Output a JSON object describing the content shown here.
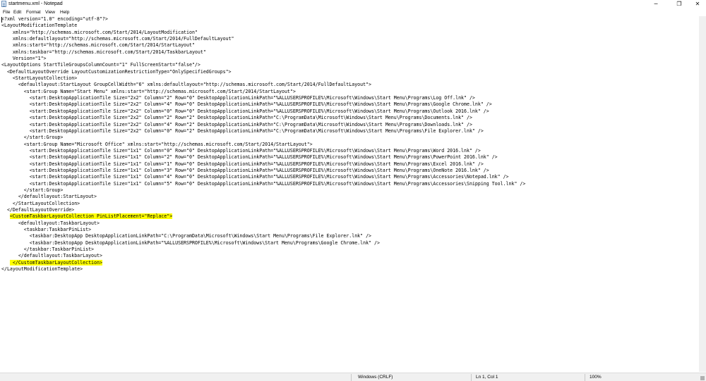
{
  "window": {
    "title": "startmenu.xml - Notepad",
    "minimize": "─",
    "maximize": "❐",
    "close": "✕"
  },
  "menu": {
    "file": "File",
    "edit": "Edit",
    "format": "Format",
    "view": "View",
    "help": "Help"
  },
  "editor": {
    "lines": [
      {
        "text": "<?xml version=\"1.0\" encoding=\"utf-8\"?>"
      },
      {
        "text": "<LayoutModificationTemplate"
      },
      {
        "text": "    xmlns=\"http://schemas.microsoft.com/Start/2014/LayoutModification\""
      },
      {
        "text": "    xmlns:defaultlayout=\"http://schemas.microsoft.com/Start/2014/FullDefaultLayout\""
      },
      {
        "text": "    xmlns:start=\"http://schemas.microsoft.com/Start/2014/StartLayout\""
      },
      {
        "text": "    xmlns:taskbar=\"http://schemas.microsoft.com/Start/2014/TaskbarLayout\""
      },
      {
        "text": "    Version=\"1\">"
      },
      {
        "text": "<LayoutOptions StartTileGroupsColumnCount=\"1\" FullScreenStart=\"false\"/>"
      },
      {
        "text": "  <DefaultLayoutOverride LayoutCustomizationRestrictionType=\"OnlySpecifiedGroups\">"
      },
      {
        "text": "    <StartLayoutCollection>"
      },
      {
        "text": "      <defaultlayout:StartLayout GroupCellWidth=\"6\" xmlns:defaultlayout=\"http://schemas.microsoft.com/Start/2014/FullDefaultLayout\">"
      },
      {
        "text": "        <start:Group Name=\"Start Menu\" xmlns:start=\"http://schemas.microsoft.com/Start/2014/StartLayout\">"
      },
      {
        "text": "          <start:DesktopApplicationTile Size=\"2x2\" Column=\"2\" Row=\"0\" DesktopApplicationLinkPath=\"%ALLUSERSPROFILE%\\Microsoft\\Windows\\Start Menu\\Programs\\Log Off.lnk\" />"
      },
      {
        "text": "          <start:DesktopApplicationTile Size=\"2x2\" Column=\"4\" Row=\"0\" DesktopApplicationLinkPath=\"%ALLUSERSPROFILE%\\Microsoft\\Windows\\Start Menu\\Programs\\Google Chrome.lnk\" />"
      },
      {
        "text": "          <start:DesktopApplicationTile Size=\"2x2\" Column=\"0\" Row=\"0\" DesktopApplicationLinkPath=\"%ALLUSERSPROFILE%\\Microsoft\\Windows\\Start Menu\\Programs\\Outlook 2016.lnk\" />"
      },
      {
        "text": "          <start:DesktopApplicationTile Size=\"2x2\" Column=\"2\" Row=\"2\" DesktopApplicationLinkPath=\"C:\\ProgramData\\Microsoft\\Windows\\Start Menu\\Programs\\Documents.lnk\" />"
      },
      {
        "text": "          <start:DesktopApplicationTile Size=\"2x2\" Column=\"4\" Row=\"2\" DesktopApplicationLinkPath=\"C:\\ProgramData\\Microsoft\\Windows\\Start Menu\\Programs\\Downloads.lnk\" />"
      },
      {
        "text": "          <start:DesktopApplicationTile Size=\"2x2\" Column=\"0\" Row=\"2\" DesktopApplicationLinkPath=\"C:\\ProgramData\\Microsoft\\Windows\\Start Menu\\Programs\\File Explorer.lnk\" />"
      },
      {
        "text": "        </start:Group>"
      },
      {
        "text": "        <start:Group Name=\"Microsoft Office\" xmlns:start=\"http://schemas.microsoft.com/Start/2014/StartLayout\">"
      },
      {
        "text": "          <start:DesktopApplicationTile Size=\"1x1\" Column=\"0\" Row=\"0\" DesktopApplicationLinkPath=\"%ALLUSERSPROFILE%\\Microsoft\\Windows\\Start Menu\\Programs\\Word 2016.lnk\" />"
      },
      {
        "text": "          <start:DesktopApplicationTile Size=\"1x1\" Column=\"2\" Row=\"0\" DesktopApplicationLinkPath=\"%ALLUSERSPROFILE%\\Microsoft\\Windows\\Start Menu\\Programs\\PowerPoint 2016.lnk\" />"
      },
      {
        "text": "          <start:DesktopApplicationTile Size=\"1x1\" Column=\"1\" Row=\"0\" DesktopApplicationLinkPath=\"%ALLUSERSPROFILE%\\Microsoft\\Windows\\Start Menu\\Programs\\Excel 2016.lnk\" />"
      },
      {
        "text": "          <start:DesktopApplicationTile Size=\"1x1\" Column=\"3\" Row=\"0\" DesktopApplicationLinkPath=\"%ALLUSERSPROFILE%\\Microsoft\\Windows\\Start Menu\\Programs\\OneNote 2016.lnk\" />"
      },
      {
        "text": "          <start:DesktopApplicationTile Size=\"1x1\" Column=\"4\" Row=\"0\" DesktopApplicationLinkPath=\"%ALLUSERSPROFILE%\\Microsoft\\Windows\\Start Menu\\Programs\\Accessories\\Notepad.lnk\" />"
      },
      {
        "text": "          <start:DesktopApplicationTile Size=\"1x1\" Column=\"5\" Row=\"0\" DesktopApplicationLinkPath=\"%ALLUSERSPROFILE%\\Microsoft\\Windows\\Start Menu\\Programs\\Accessories\\Snipping Tool.lnk\" />"
      },
      {
        "text": "        </start:Group>"
      },
      {
        "text": "      </defaultlayout:StartLayout>"
      },
      {
        "text": "    </StartLayoutCollection>"
      },
      {
        "text": "  </DefaultLayoutOverride>"
      },
      {
        "pre": "   ",
        "hl": "<CustomTaskbarLayoutCollection PinListPlacement=\"Replace\">",
        "post": ""
      },
      {
        "text": "      <defaultlayout:TaskbarLayout>"
      },
      {
        "text": "        <taskbar:TaskbarPinList>"
      },
      {
        "text": "          <taskbar:DesktopApp DesktopApplicationLinkPath=\"C:\\ProgramData\\Microsoft\\Windows\\Start Menu\\Programs\\File Explorer.lnk\" />"
      },
      {
        "text": "          <taskbar:DesktopApp DesktopApplicationLinkPath=\"%ALLUSERSPROFILE%\\Microsoft\\Windows\\Start Menu\\Programs\\Google Chrome.lnk\" />"
      },
      {
        "text": "        </taskbar:TaskbarPinList>"
      },
      {
        "text": "      </defaultlayout:TaskbarLayout>"
      },
      {
        "pre": "   ",
        "hl": " </CustomTaskbarLayoutCollection>",
        "post": ""
      },
      {
        "text": "</LayoutModificationTemplate>"
      }
    ]
  },
  "status": {
    "line_ending": "Windows (CRLF)",
    "position": "Ln 1, Col 1",
    "zoom": "100%"
  },
  "colors": {
    "highlight": "#ffff00",
    "statusbar": "#f0f0f0"
  }
}
